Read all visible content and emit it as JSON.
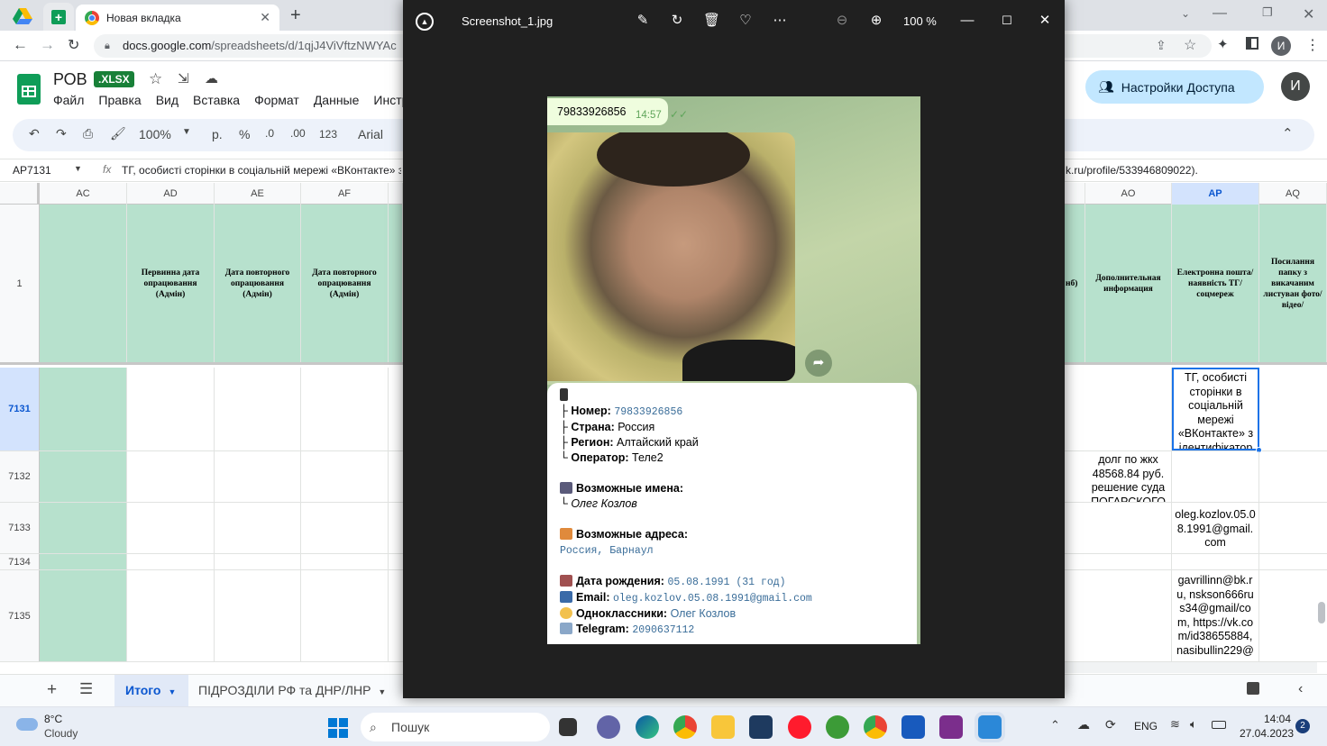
{
  "browser": {
    "tab_title": "Новая вкладка",
    "url_host": "docs.google.com",
    "url_path": "/spreadsheets/d/1qjJ4ViVftzNWYAc",
    "profile_initial": "И"
  },
  "sheets": {
    "doc_title": "РОВ",
    "badge": ".XLSX",
    "menu": [
      "Файл",
      "Правка",
      "Вид",
      "Вставка",
      "Формат",
      "Данные",
      "Инстр"
    ],
    "share_label": "Настройки Доступа",
    "avatar": "И",
    "toolbar": {
      "zoom": "100%",
      "currency": "р.",
      "percent": "%",
      "dec_less": ".0",
      "dec_more": ".00",
      "num_format": "123",
      "font": "Arial"
    },
    "cell_ref": "AP7131",
    "formula_left": "ТГ, особисті сторінки в соціальній мережі «ВКонтакте» з",
    "formula_right": "k.ru/profile/533946809022).",
    "columns_left": [
      "AC",
      "AD",
      "AE",
      "AF"
    ],
    "columns_right": [
      "AO",
      "AP",
      "AQ"
    ],
    "header_row_num": "1",
    "header_cells": {
      "AD": "Первинна дата опрацювання (Адмін)",
      "AE": "Дата повторного опрацювання (Адмін)",
      "AF": "Дата повторного опрацювання (Адмін)",
      "AN_tail": "нб)",
      "AO": "Дополнительная информация",
      "AP": "Електронна пошта/наявність ТГ/соцмереж",
      "AQ": "Посилання папку з викачаним листуван фото/відео/"
    },
    "rows": [
      {
        "num": "7131",
        "AO": "",
        "AP": "ТГ, особисті сторінки в соціальній мережі «ВКонтакте» з ідентифікатор"
      },
      {
        "num": "7132",
        "AO": "долг по жкх 48568.84 руб. решение суда ПОГАРСКОГО",
        "AP": ""
      },
      {
        "num": "7133",
        "AO": "",
        "AP": "oleg.kozlov.05.08.1991@gmail.com"
      },
      {
        "num": "7134",
        "AO": "",
        "AP": ""
      },
      {
        "num": "7135",
        "AO": "",
        "AP": "gavrillinn@bk.ru, nskson666rus34@gmail/com, https://vk.com/id38655884, nasibullin229@"
      }
    ],
    "sheet_tabs": [
      "Итого",
      "ПІДРОЗДІЛИ РФ та ДНР/ЛНР"
    ]
  },
  "viewer": {
    "title": "Screenshot_1.jpg",
    "zoom": "100 %",
    "telegram": {
      "top_number": "79833926856",
      "top_time": "14:57",
      "number_label": "Номер:",
      "number_value": "79833926856",
      "country_label": "Страна:",
      "country_value": "Россия",
      "region_label": "Регион:",
      "region_value": "Алтайский край",
      "operator_label": "Оператор:",
      "operator_value": "Теле2",
      "names_label": "Возможные имена:",
      "names_value": "Олег Козлов",
      "address_label": "Возможные адреса:",
      "address_value": "Россия, Барнаул",
      "dob_label": "Дата рождения:",
      "dob_value": "05.08.1991 (31 год)",
      "email_label": "Email:",
      "email_value": "oleg.kozlov.05.08.1991@gmail.com",
      "ok_label": "Одноклассники:",
      "ok_value": "Олег Козлов",
      "tg_label": "Telegram:",
      "tg_value": "2090637112"
    }
  },
  "taskbar": {
    "weather_temp": "8°C",
    "weather_desc": "Cloudy",
    "search": "Пошук",
    "lang": "ENG",
    "time": "14:04",
    "date": "27.04.2023",
    "notif": "2"
  }
}
